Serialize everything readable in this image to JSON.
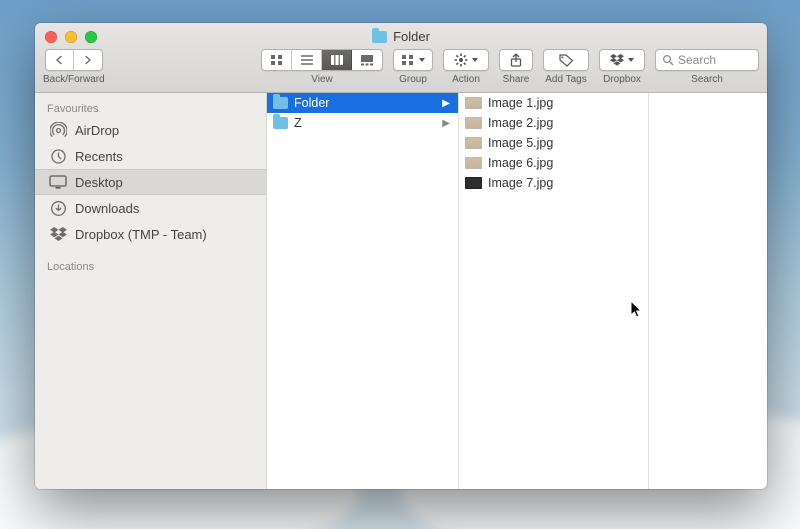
{
  "window_title": "Folder",
  "toolbar": {
    "back_forward_label": "Back/Forward",
    "view_label": "View",
    "group_label": "Group",
    "action_label": "Action",
    "share_label": "Share",
    "add_tags_label": "Add Tags",
    "dropbox_label": "Dropbox",
    "search_label": "Search",
    "search_placeholder": "Search"
  },
  "sidebar": {
    "favourites_header": "Favourites",
    "locations_header": "Locations",
    "items": [
      {
        "label": "AirDrop"
      },
      {
        "label": "Recents"
      },
      {
        "label": "Desktop"
      },
      {
        "label": "Downloads"
      },
      {
        "label": "Dropbox (TMP - Team)"
      }
    ]
  },
  "columns": {
    "col1": [
      {
        "label": "Folder",
        "selected": true
      },
      {
        "label": "Z",
        "selected": false
      }
    ],
    "col2": [
      {
        "label": "Image 1.jpg"
      },
      {
        "label": "Image 2.jpg"
      },
      {
        "label": "Image 5.jpg"
      },
      {
        "label": "Image 6.jpg"
      },
      {
        "label": "Image 7.jpg"
      }
    ]
  }
}
